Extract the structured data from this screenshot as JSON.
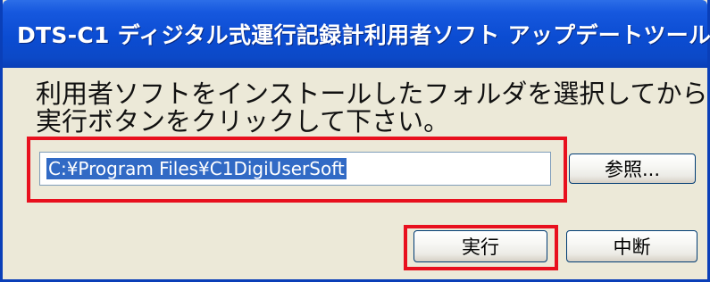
{
  "window": {
    "title": "DTS-C1 ディジタル式運行記録計利用者ソフト アップデートツール"
  },
  "instruction": {
    "line1": "利用者ソフトをインストールしたフォルダを選択してから",
    "line2": "実行ボタンをクリックして下さい。"
  },
  "path_field": {
    "value": "C:¥Program Files¥C1DigiUserSoft"
  },
  "buttons": {
    "browse_label": "参照...",
    "run_label": "実行",
    "cancel_label": "中断"
  },
  "colors": {
    "title_bar": "#0b4cd2",
    "highlight_box": "#e8101e",
    "selection": "#316ac5",
    "dialog_background": "#ece9d8"
  }
}
